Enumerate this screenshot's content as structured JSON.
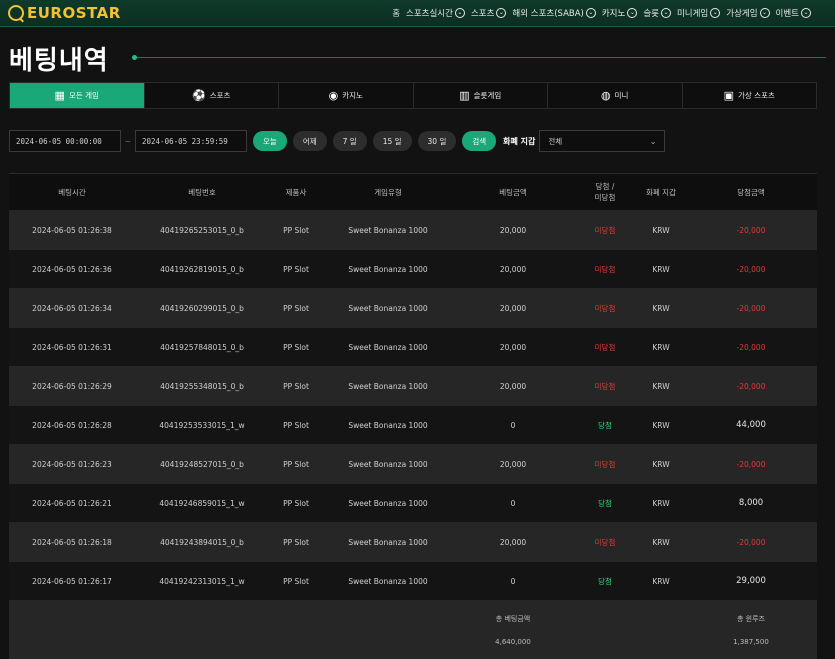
{
  "brand": {
    "name": "EUROSTAR"
  },
  "nav": [
    {
      "label": "홈",
      "chevron": false
    },
    {
      "label": "스포츠실시간",
      "chevron": true
    },
    {
      "label": "스포츠",
      "chevron": true
    },
    {
      "label": "해외 스포츠(SABA)",
      "chevron": true
    },
    {
      "label": "카지노",
      "chevron": true
    },
    {
      "label": "슬롯",
      "chevron": true
    },
    {
      "label": "미니게임",
      "chevron": true
    },
    {
      "label": "가상게임",
      "chevron": true
    },
    {
      "label": "이벤트",
      "chevron": true
    }
  ],
  "page_title": "베팅내역",
  "tabs": [
    {
      "label": "모든 게임",
      "icon": "grid-icon",
      "glyph": "▦",
      "active": true
    },
    {
      "label": "스포츠",
      "icon": "soccer-ball-icon",
      "glyph": "⚽",
      "active": false
    },
    {
      "label": "카지노",
      "icon": "casino-chip-icon",
      "glyph": "◉",
      "active": false
    },
    {
      "label": "슬롯게임",
      "icon": "slot-machine-icon",
      "glyph": "▥",
      "active": false
    },
    {
      "label": "미니",
      "icon": "gamepad-icon",
      "glyph": "◍",
      "active": false
    },
    {
      "label": "가상 스포츠",
      "icon": "vr-headset-icon",
      "glyph": "▣",
      "active": false
    }
  ],
  "filters": {
    "date_from": "2024-06-05 00:00:00",
    "date_to": "2024-06-05 23:59:59",
    "tilde": "~",
    "quick": [
      "오늘",
      "어제",
      "7 일",
      "15 일",
      "30 일"
    ],
    "search_label": "검색",
    "currency_label": "화폐 지갑",
    "currency_value": "전체"
  },
  "table": {
    "headers": [
      "베팅시간",
      "베팅번호",
      "제품사",
      "게임유형",
      "베팅금액",
      "당첨 / 미당첨",
      "화폐 지갑",
      "당첨금액"
    ],
    "rows": [
      {
        "time": "2024-06-05 01:26:38",
        "id": "40419265253015_0_b",
        "vendor": "PP Slot",
        "game": "Sweet Bonanza 1000",
        "bet": "20,000",
        "result": "미당첨",
        "win": false,
        "currency": "KRW",
        "payout": "-20,000"
      },
      {
        "time": "2024-06-05 01:26:36",
        "id": "40419262819015_0_b",
        "vendor": "PP Slot",
        "game": "Sweet Bonanza 1000",
        "bet": "20,000",
        "result": "미당첨",
        "win": false,
        "currency": "KRW",
        "payout": "-20,000"
      },
      {
        "time": "2024-06-05 01:26:34",
        "id": "40419260299015_0_b",
        "vendor": "PP Slot",
        "game": "Sweet Bonanza 1000",
        "bet": "20,000",
        "result": "미당첨",
        "win": false,
        "currency": "KRW",
        "payout": "-20,000"
      },
      {
        "time": "2024-06-05 01:26:31",
        "id": "40419257848015_0_b",
        "vendor": "PP Slot",
        "game": "Sweet Bonanza 1000",
        "bet": "20,000",
        "result": "미당첨",
        "win": false,
        "currency": "KRW",
        "payout": "-20,000"
      },
      {
        "time": "2024-06-05 01:26:29",
        "id": "40419255348015_0_b",
        "vendor": "PP Slot",
        "game": "Sweet Bonanza 1000",
        "bet": "20,000",
        "result": "미당첨",
        "win": false,
        "currency": "KRW",
        "payout": "-20,000"
      },
      {
        "time": "2024-06-05 01:26:28",
        "id": "40419253533015_1_w",
        "vendor": "PP Slot",
        "game": "Sweet Bonanza 1000",
        "bet": "0",
        "result": "당첨",
        "win": true,
        "currency": "KRW",
        "payout": "44,000"
      },
      {
        "time": "2024-06-05 01:26:23",
        "id": "40419248527015_0_b",
        "vendor": "PP Slot",
        "game": "Sweet Bonanza 1000",
        "bet": "20,000",
        "result": "미당첨",
        "win": false,
        "currency": "KRW",
        "payout": "-20,000"
      },
      {
        "time": "2024-06-05 01:26:21",
        "id": "40419246859015_1_w",
        "vendor": "PP Slot",
        "game": "Sweet Bonanza 1000",
        "bet": "0",
        "result": "당첨",
        "win": true,
        "currency": "KRW",
        "payout": "8,000"
      },
      {
        "time": "2024-06-05 01:26:18",
        "id": "40419243894015_0_b",
        "vendor": "PP Slot",
        "game": "Sweet Bonanza 1000",
        "bet": "20,000",
        "result": "미당첨",
        "win": false,
        "currency": "KRW",
        "payout": "-20,000"
      },
      {
        "time": "2024-06-05 01:26:17",
        "id": "40419242313015_1_w",
        "vendor": "PP Slot",
        "game": "Sweet Bonanza 1000",
        "bet": "0",
        "result": "당첨",
        "win": true,
        "currency": "KRW",
        "payout": "29,000"
      }
    ],
    "summary": {
      "bet_total_label": "총 베팅금액",
      "bet_total_value": "4,640,000",
      "profit_label": "총 윈루즈",
      "profit_value": "1,387,500"
    }
  },
  "colors": {
    "accent": "#1ba878",
    "lose": "#e03a3a",
    "win": "#29d67b",
    "brand": "#f2c230"
  }
}
